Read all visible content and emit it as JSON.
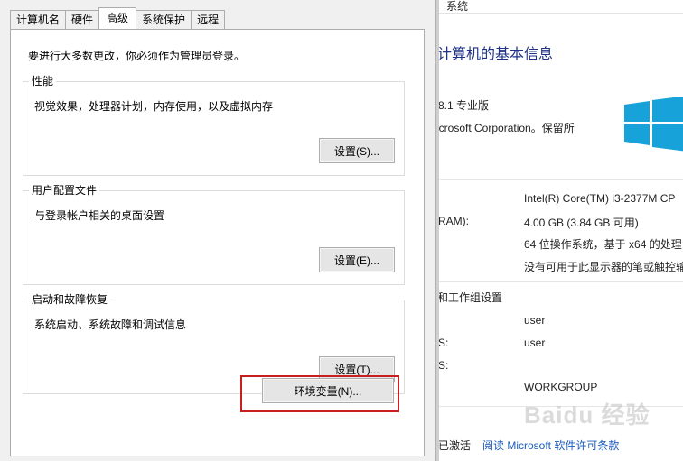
{
  "dialog": {
    "tabs": [
      "计算机名",
      "硬件",
      "高级",
      "系统保护",
      "远程"
    ],
    "active_tab": "高级",
    "intro": "要进行大多数更改，你必须作为管理员登录。",
    "groups": [
      {
        "title": "性能",
        "description": "视觉效果，处理器计划，内存使用，以及虚拟内存",
        "button": "设置(S)..."
      },
      {
        "title": "用户配置文件",
        "description": "与登录帐户相关的桌面设置",
        "button": "设置(E)..."
      },
      {
        "title": "启动和故障恢复",
        "description": "系统启动、系统故障和调试信息",
        "button": "设置(T)..."
      }
    ],
    "env_button": "环境变量(N)...",
    "highlight_color": "#c91e1e"
  },
  "system_window": {
    "title": "系统",
    "heading": "计算机的基本信息",
    "edition": "8.1 专业版",
    "copyright": "icrosoft Corporation。保留所",
    "processor": "Intel(R) Core(TM) i3-2377M CP",
    "ram_label": "RAM):",
    "ram_value": "4.00 GB (3.84 GB 可用)",
    "system_type": "64 位操作系统，基于 x64 的处理",
    "pen_touch": "没有可用于此显示器的笔或触控输",
    "section_computer": "和工作组设置",
    "computer_name": "user",
    "full_name_label": "S:",
    "full_name": "user",
    "description_label": "S:",
    "workgroup": "WORKGROUP",
    "activation_label": "已激活",
    "activation_link": "阅读 Microsoft 软件许可条款",
    "logo_color": "#17a2d9",
    "heading_color": "#1e3287",
    "link_color": "#1a5bbd"
  },
  "watermark": "Baidu 经验"
}
